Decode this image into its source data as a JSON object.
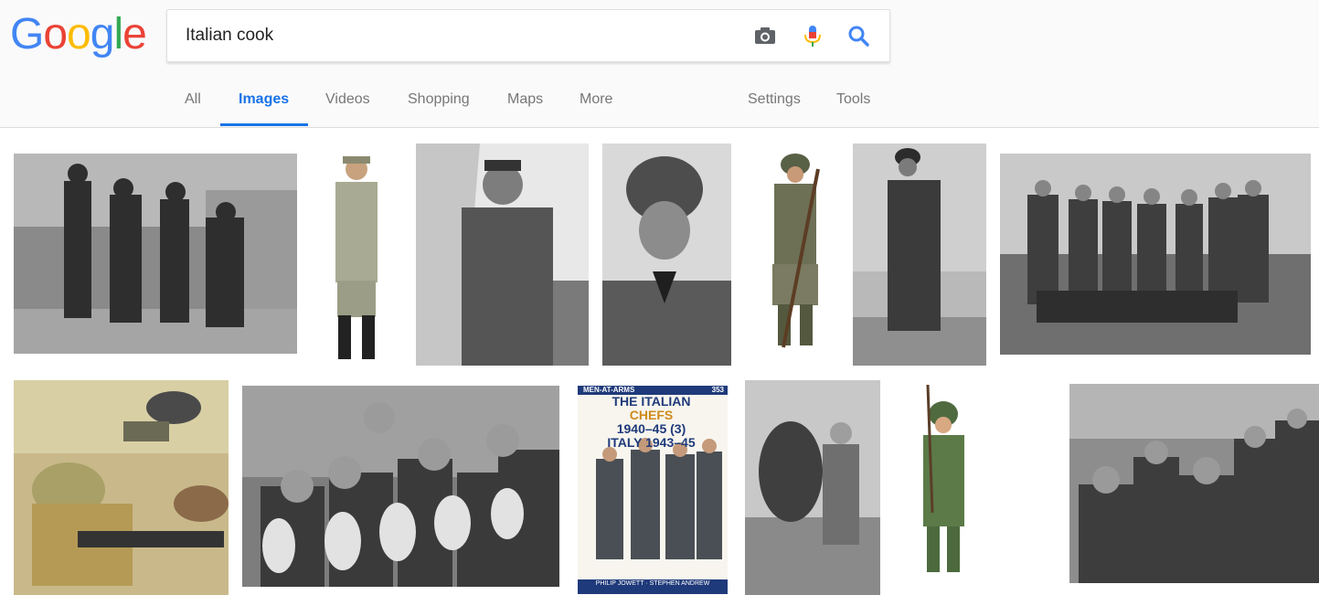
{
  "logo": {
    "letters": [
      "G",
      "o",
      "o",
      "g",
      "l",
      "e"
    ],
    "colors": [
      "#4285F4",
      "#EA4335",
      "#FBBC05",
      "#4285F4",
      "#34A853",
      "#EA4335"
    ]
  },
  "search": {
    "query": "Italian cook"
  },
  "icons": {
    "camera": "camera-icon",
    "mic": "microphone-icon",
    "search": "search-icon"
  },
  "tabs": {
    "all": "All",
    "images": "Images",
    "videos": "Videos",
    "shopping": "Shopping",
    "maps": "Maps",
    "more": "More",
    "settings": "Settings",
    "tools": "Tools"
  },
  "accent_color": "#1a73e8",
  "cover": {
    "series": "MEN-AT-ARMS",
    "number": "353",
    "title_line1": "THE ITALIAN",
    "title_word": "CHEFS",
    "title_line2": "1940–45 (3)",
    "title_line3": "ITALY 1943–45",
    "authors": "PHILIP JOWETT · STEPHEN ANDREW"
  }
}
